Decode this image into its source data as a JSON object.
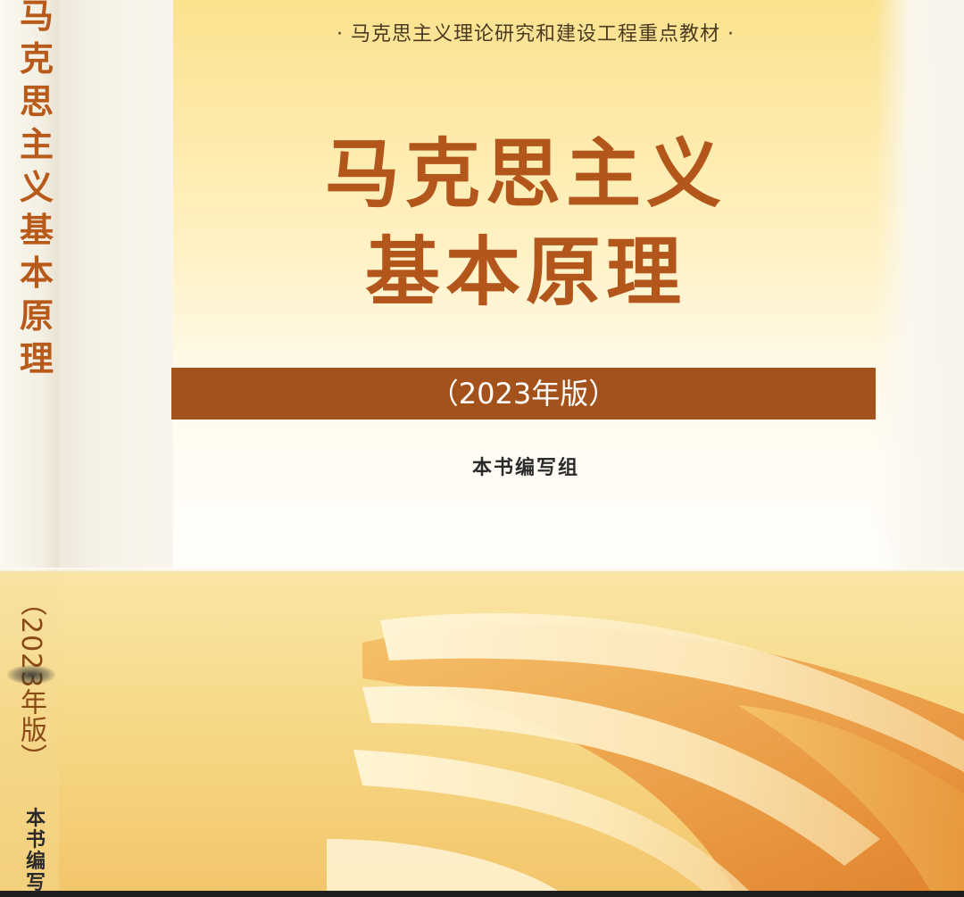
{
  "cover": {
    "series": "· 马克思主义理论研究和建设工程重点教材 ·",
    "title_line1": "马克思主义",
    "title_line2": "基本原理",
    "edition": "（2023年版）",
    "author": "本书编写组"
  },
  "spine": {
    "title": "马克思主义基本原理",
    "edition": "（2023年版）",
    "author": "本书编写"
  },
  "colors": {
    "title": "#b2561c",
    "band": "#a4521c",
    "cover_yellow": "#fbe28e"
  }
}
